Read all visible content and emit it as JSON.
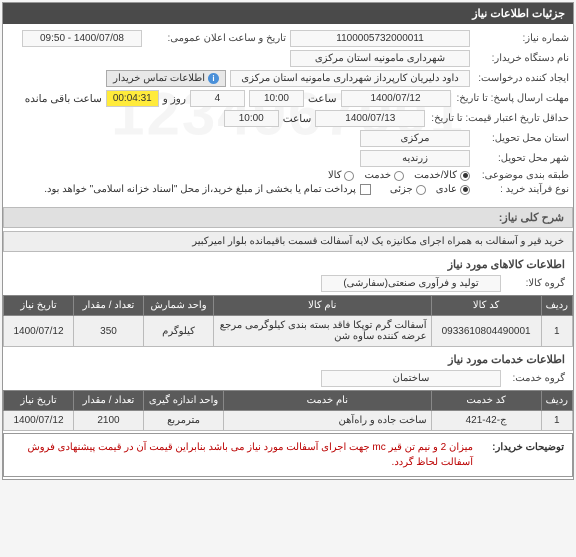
{
  "panel_title": "جزئیات اطلاعات نیاز",
  "watermark": "1234967001",
  "fields": {
    "need_no_label": "شماره نیاز:",
    "need_no": "1100005732000011",
    "announce_label": "تاریخ و ساعت اعلان عمومی:",
    "announce_val": "1400/07/08 - 09:50",
    "buyer_name_label": "نام دستگاه خریدار:",
    "buyer_name": "شهرداری مامونیه استان مرکزی",
    "creator_label": "ایجاد کننده درخواست:",
    "creator": "داود  دلیریان  کارپرداز  شهرداری مامونیه استان مرکزی",
    "contact_btn": "اطلاعات تماس خریدار",
    "deadline_label": "مهلت ارسال پاسخ: تا تاریخ:",
    "deadline_date": "1400/07/12",
    "saat": "ساعت",
    "deadline_time": "10:00",
    "days": "4",
    "rooz_va": "روز و",
    "countdown": "00:04:31",
    "baghi": "ساعت باقی مانده",
    "validity_label": "حداقل تاریخ اعتبار قیمت: تا تاریخ:",
    "validity_date": "1400/07/13",
    "validity_time": "10:00",
    "province_label": "استان محل تحویل:",
    "province": "مرکزی",
    "city_label": "شهر محل تحویل:",
    "city": "زرندیه",
    "category_label": "طبقه بندی موضوعی:",
    "cat_kala": "کالا/خدمت",
    "cat_khadmat": "خدمت",
    "cat_kala_only": "کالا",
    "process_label": "نوع فرآیند خرید :",
    "proc_normal": "عادی",
    "proc_partial": "جزئی",
    "payment_note": "پرداخت تمام یا بخشی از مبلغ خرید،از محل \"اسناد خزانه اسلامی\" خواهد بود."
  },
  "desc": {
    "title": "شرح کلی نیاز:",
    "text": "خرید قیر و آسفالت به همراه اجرای مکانیزه یک لایه آسفالت قسمت باقیمانده بلوار امیرکبیر"
  },
  "goods": {
    "header": "اطلاعات کالاهای مورد نیاز",
    "group_label": "گروه کالا:",
    "group_val": "تولید و فرآوری صنعتی(سفارشی)",
    "cols": {
      "row": "ردیف",
      "code": "کد کالا",
      "name": "نام کالا",
      "unit": "واحد شمارش",
      "qty": "تعداد / مقدار",
      "date": "تاریخ نیاز"
    },
    "rows": [
      {
        "row": "1",
        "code": "0933610804490001",
        "name": "آسفالت گرم توپکا فاقد بسته بندی کیلوگرمی مرجع عرضه کننده ساوه شن",
        "unit": "کیلوگرم",
        "qty": "350",
        "date": "1400/07/12"
      }
    ]
  },
  "services": {
    "header": "اطلاعات خدمات مورد نیاز",
    "group_label": "گروه خدمت:",
    "group_val": "ساختمان",
    "cols": {
      "row": "ردیف",
      "code": "کد خدمت",
      "name": "نام خدمت",
      "unit": "واحد اندازه گیری",
      "qty": "تعداد / مقدار",
      "date": "تاریخ نیاز"
    },
    "rows": [
      {
        "row": "1",
        "code": "ج-42-421",
        "name": "ساخت جاده و راه‌آهن",
        "unit": "مترمربع",
        "qty": "2100",
        "date": "1400/07/12"
      }
    ]
  },
  "buyer_note": {
    "label": "توضیحات خریدار:",
    "text": "میزان 2 و نیم تن قیر mc جهت اجرای آسفالت مورد نیاز می باشد بنابراین قیمت آن در قیمت پیشنهادی فروش آسفالت لحاظ گردد."
  }
}
